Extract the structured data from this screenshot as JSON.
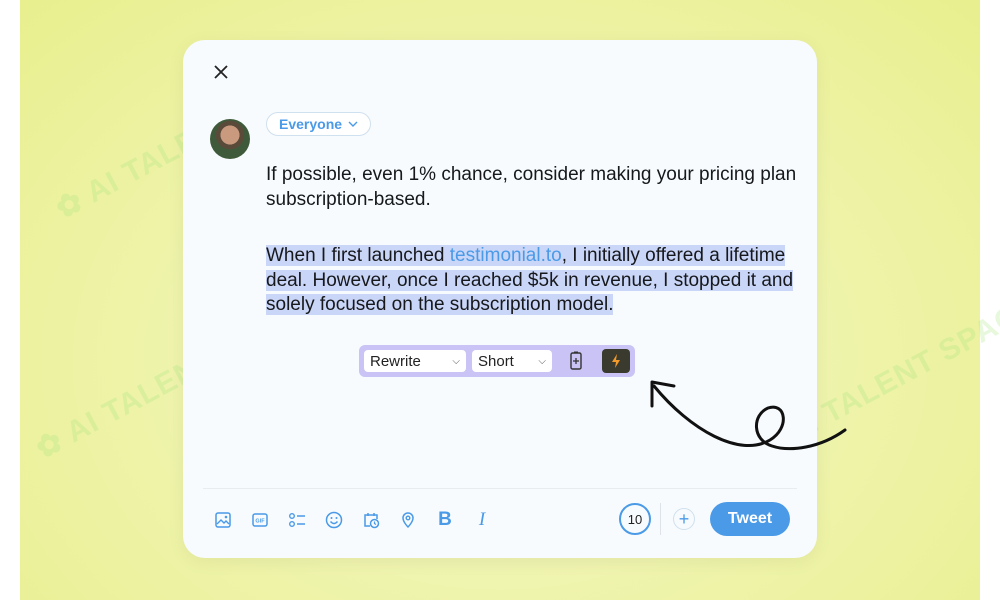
{
  "watermark": "AI TALENT SPACE",
  "composer": {
    "audience": "Everyone",
    "paragraph1": "If possible, even 1% chance, consider making your pricing plan subscription-based.",
    "paragraph2_before": "When I first launched ",
    "paragraph2_link": "testimonial.to",
    "paragraph2_after": ", I initially offered a lifetime deal. However, once I reached $5k in revenue, I stopped it and solely focused on the subscription model."
  },
  "ai_toolbar": {
    "action": "Rewrite",
    "length": "Short"
  },
  "footer": {
    "icons": [
      "image-icon",
      "gif-icon",
      "poll-icon",
      "emoji-icon",
      "schedule-icon",
      "location-icon",
      "bold-icon",
      "italic-icon"
    ],
    "bold_label": "B",
    "italic_label": "I",
    "char_remaining": "10",
    "tweet_label": "Tweet"
  },
  "colors": {
    "accent": "#4a9ae8",
    "highlight": "#cad6f7",
    "ai_toolbar": "#c9c4f5"
  }
}
